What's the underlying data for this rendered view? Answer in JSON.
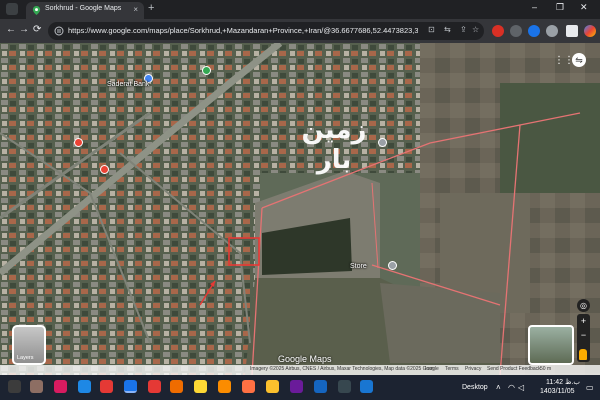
{
  "browser": {
    "tab_title": "Sorkhrud - Google Maps",
    "tab_close": "×",
    "new_tab": "+",
    "url": "https://www.google.com/maps/place/Sorkhrud,+Mazandaran+Province,+Iran/@36.6677686,52.4473823,374m/data...",
    "window_controls": [
      "–",
      "❐",
      "✕"
    ],
    "nav": {
      "back": "←",
      "forward": "→",
      "reload": "⟳"
    }
  },
  "map": {
    "watermark_text": "زمین بار",
    "labels": {
      "saderat": "Saderat Bank",
      "store": "Store"
    },
    "google_logo": "Google Maps",
    "attribution": "Imagery ©2025 Airbus, CNES / Airbus, Maxar Technologies, Map data ©2025 Google",
    "attr_links": [
      "Iran",
      "Terms",
      "Privacy",
      "Send Product Feedback",
      "50 m"
    ],
    "layers_label": "Layers",
    "zoom_in": "+",
    "zoom_out": "−",
    "colors": {
      "plot_outline": "#e57373",
      "highlight_box": "#e53935",
      "arrow": "#e53935"
    }
  },
  "taskbar": {
    "desktop_label": "Desktop",
    "time": "11:42 ب.ظ",
    "date": "1403/11/05"
  }
}
